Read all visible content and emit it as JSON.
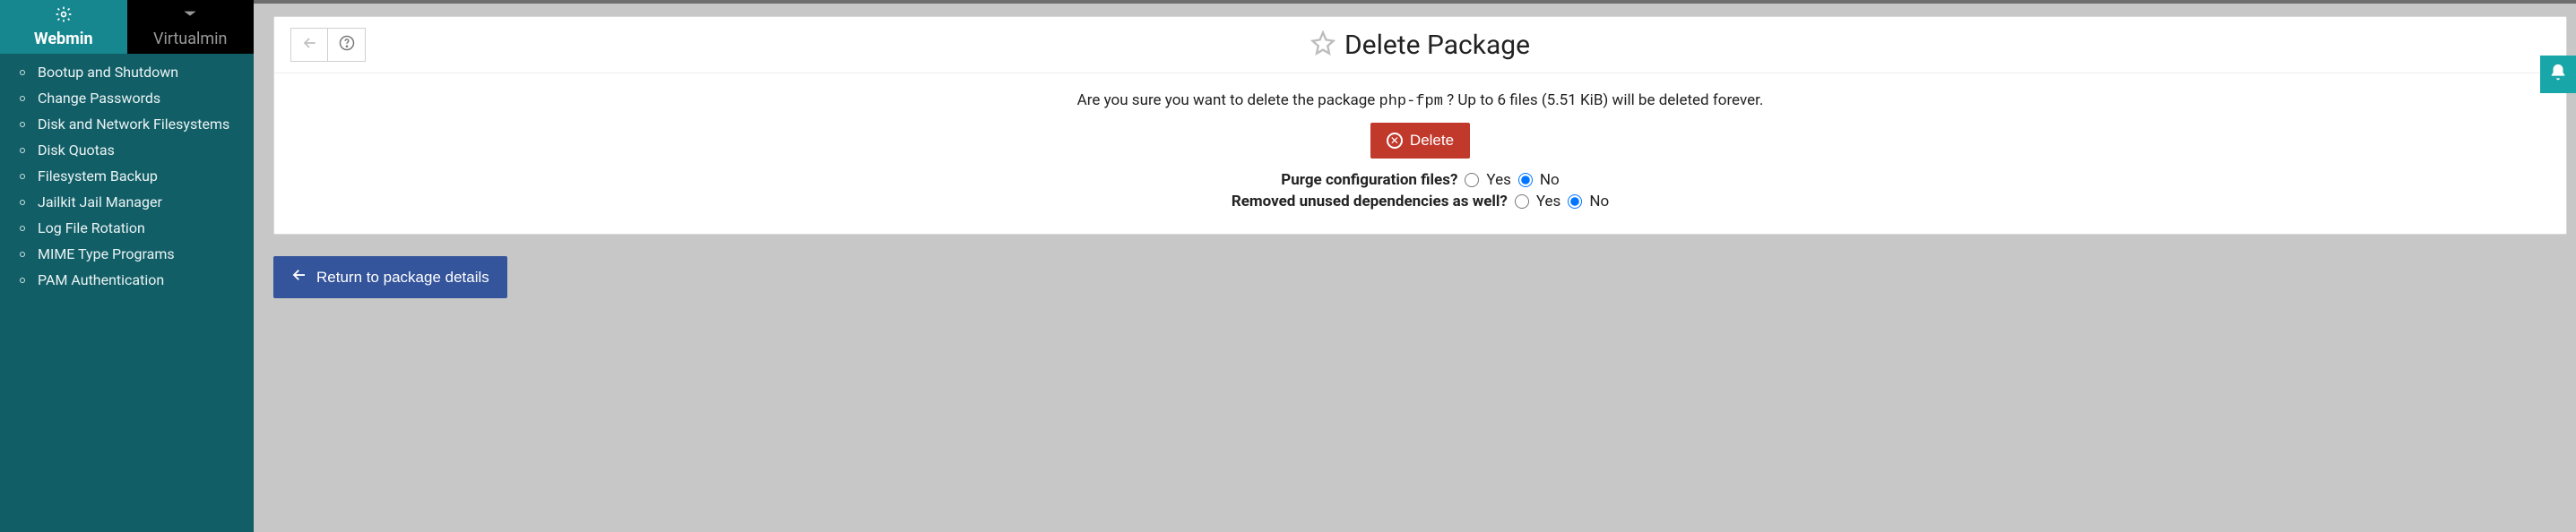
{
  "sidebar": {
    "tabs": {
      "webmin": "Webmin",
      "virtualmin": "Virtualmin"
    },
    "items": [
      {
        "label": "Bootup and Shutdown"
      },
      {
        "label": "Change Passwords"
      },
      {
        "label": "Disk and Network Filesystems"
      },
      {
        "label": "Disk Quotas"
      },
      {
        "label": "Filesystem Backup"
      },
      {
        "label": "Jailkit Jail Manager"
      },
      {
        "label": "Log File Rotation"
      },
      {
        "label": "MIME Type Programs"
      },
      {
        "label": "PAM Authentication"
      }
    ]
  },
  "header": {
    "title": "Delete Package"
  },
  "confirm": {
    "prefix": "Are you sure you want to delete the package ",
    "package_name": "php-fpm",
    "suffix": " ? Up to 6 files (5.51 KiB) will be deleted forever."
  },
  "buttons": {
    "delete": "Delete",
    "return": "Return to package details"
  },
  "options": {
    "purge": {
      "label": "Purge configuration files?",
      "yes": "Yes",
      "no": "No",
      "selected": "no"
    },
    "deps": {
      "label": "Removed unused dependencies as well?",
      "yes": "Yes",
      "no": "No",
      "selected": "no"
    }
  }
}
